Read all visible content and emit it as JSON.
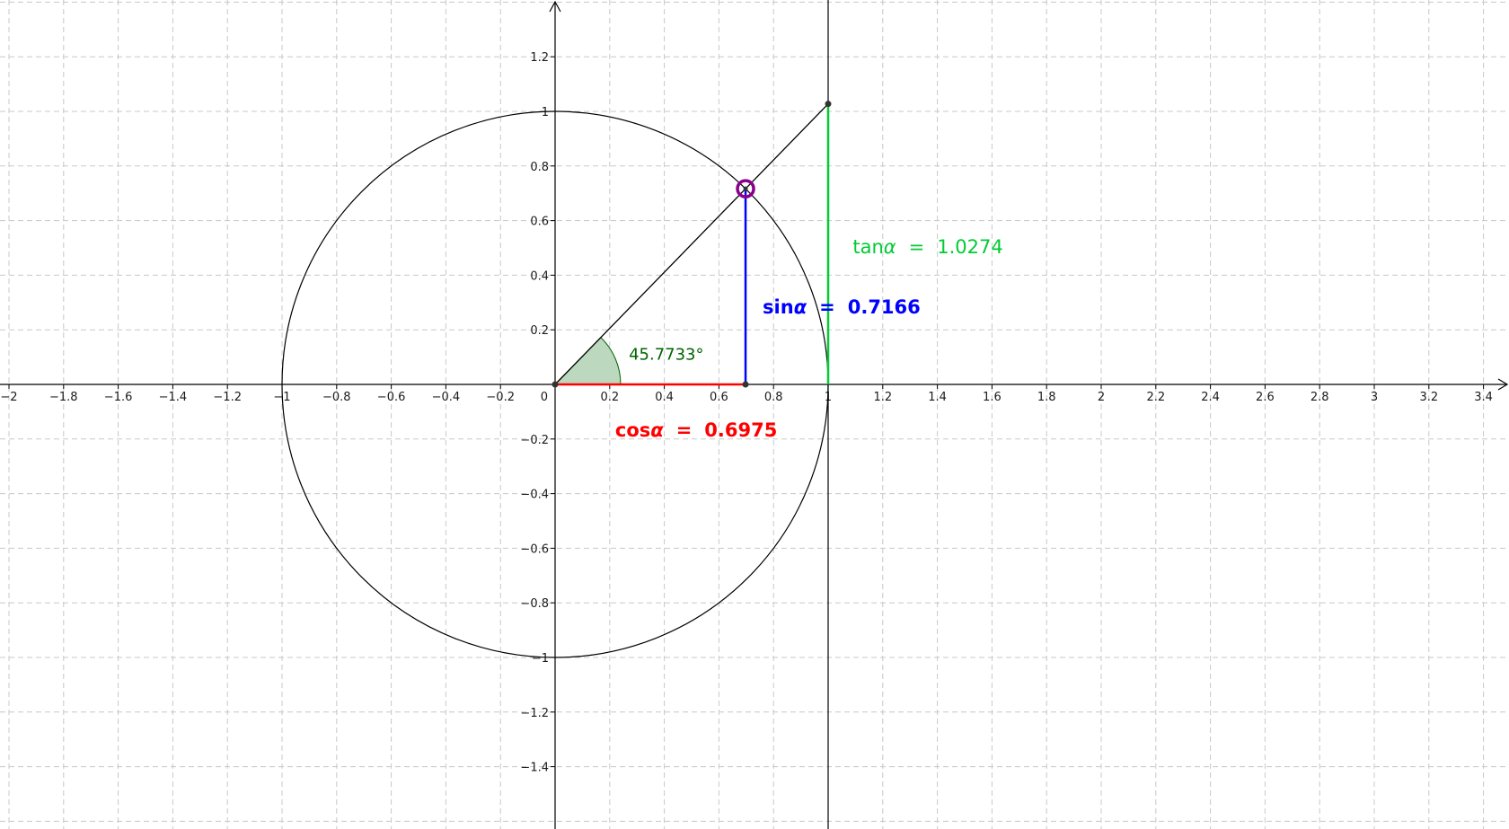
{
  "graph": {
    "x_range": [
      -2,
      3.4
    ],
    "y_range": [
      -1.5,
      1.4
    ],
    "grid_step": 0.2,
    "grid": true,
    "x_tick_labels": [
      "−2",
      "−1.8",
      "−1.6",
      "−1.4",
      "−1.2",
      "−1",
      "−0.8",
      "−0.6",
      "−0.4",
      "−0.2",
      "0",
      "0.2",
      "0.4",
      "0.6",
      "0.8",
      "1",
      "1.2",
      "1.4",
      "1.6",
      "1.8",
      "2",
      "2.2",
      "2.4",
      "2.6",
      "2.8",
      "3",
      "3.2",
      "3.4"
    ],
    "y_tick_labels": [
      "1.2",
      "1",
      "0.8",
      "0.6",
      "0.4",
      "0.2",
      "−0.2",
      "−0.4",
      "−0.6",
      "−0.8",
      "−1",
      "−1.2",
      "−1.4"
    ],
    "y_tick_values": [
      1.2,
      1,
      0.8,
      0.6,
      0.4,
      0.2,
      -0.2,
      -0.4,
      -0.6,
      -0.8,
      -1,
      -1.2,
      -1.4
    ]
  },
  "unit_circle": {
    "center": [
      0,
      0
    ],
    "radius": 1
  },
  "tangent_line_x": 1,
  "angle": {
    "degrees": 45.7733,
    "label": "45.7733°",
    "fill_color": "#bcd9bf",
    "color": "#006400"
  },
  "point": {
    "x": 0.6975,
    "y": 0.7166,
    "color": "#8b008b"
  },
  "cos": {
    "prefix": "cos",
    "symbol": "α",
    "equals": "=",
    "value": "0.6975",
    "color": "#ff0000"
  },
  "sin": {
    "prefix": "sin",
    "symbol": "α",
    "equals": "=",
    "value": "0.7166",
    "color": "#0000ff"
  },
  "tan": {
    "prefix": "tan",
    "symbol": "α",
    "equals": "=",
    "value": "1.0274",
    "numeric": 1.0274,
    "color": "#00cc33"
  }
}
